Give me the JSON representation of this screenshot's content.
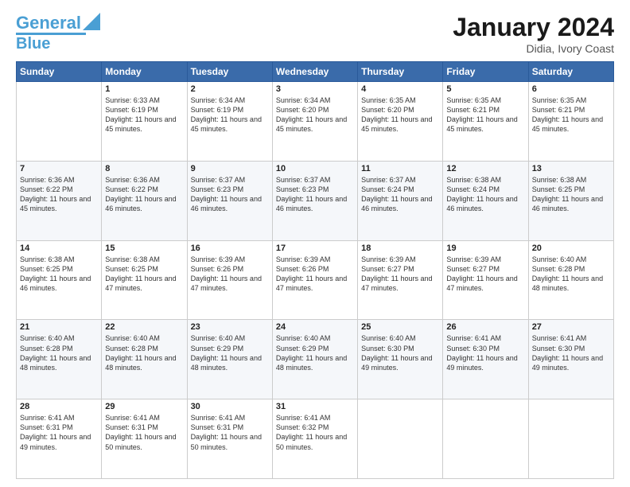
{
  "header": {
    "logo": {
      "line1": "General",
      "line2": "Blue"
    },
    "title": "January 2024",
    "location": "Didia, Ivory Coast"
  },
  "days_of_week": [
    "Sunday",
    "Monday",
    "Tuesday",
    "Wednesday",
    "Thursday",
    "Friday",
    "Saturday"
  ],
  "weeks": [
    [
      {
        "day": "",
        "sunrise": "",
        "sunset": "",
        "daylight": ""
      },
      {
        "day": "1",
        "sunrise": "Sunrise: 6:33 AM",
        "sunset": "Sunset: 6:19 PM",
        "daylight": "Daylight: 11 hours and 45 minutes."
      },
      {
        "day": "2",
        "sunrise": "Sunrise: 6:34 AM",
        "sunset": "Sunset: 6:19 PM",
        "daylight": "Daylight: 11 hours and 45 minutes."
      },
      {
        "day": "3",
        "sunrise": "Sunrise: 6:34 AM",
        "sunset": "Sunset: 6:20 PM",
        "daylight": "Daylight: 11 hours and 45 minutes."
      },
      {
        "day": "4",
        "sunrise": "Sunrise: 6:35 AM",
        "sunset": "Sunset: 6:20 PM",
        "daylight": "Daylight: 11 hours and 45 minutes."
      },
      {
        "day": "5",
        "sunrise": "Sunrise: 6:35 AM",
        "sunset": "Sunset: 6:21 PM",
        "daylight": "Daylight: 11 hours and 45 minutes."
      },
      {
        "day": "6",
        "sunrise": "Sunrise: 6:35 AM",
        "sunset": "Sunset: 6:21 PM",
        "daylight": "Daylight: 11 hours and 45 minutes."
      }
    ],
    [
      {
        "day": "7",
        "sunrise": "Sunrise: 6:36 AM",
        "sunset": "Sunset: 6:22 PM",
        "daylight": "Daylight: 11 hours and 45 minutes."
      },
      {
        "day": "8",
        "sunrise": "Sunrise: 6:36 AM",
        "sunset": "Sunset: 6:22 PM",
        "daylight": "Daylight: 11 hours and 46 minutes."
      },
      {
        "day": "9",
        "sunrise": "Sunrise: 6:37 AM",
        "sunset": "Sunset: 6:23 PM",
        "daylight": "Daylight: 11 hours and 46 minutes."
      },
      {
        "day": "10",
        "sunrise": "Sunrise: 6:37 AM",
        "sunset": "Sunset: 6:23 PM",
        "daylight": "Daylight: 11 hours and 46 minutes."
      },
      {
        "day": "11",
        "sunrise": "Sunrise: 6:37 AM",
        "sunset": "Sunset: 6:24 PM",
        "daylight": "Daylight: 11 hours and 46 minutes."
      },
      {
        "day": "12",
        "sunrise": "Sunrise: 6:38 AM",
        "sunset": "Sunset: 6:24 PM",
        "daylight": "Daylight: 11 hours and 46 minutes."
      },
      {
        "day": "13",
        "sunrise": "Sunrise: 6:38 AM",
        "sunset": "Sunset: 6:25 PM",
        "daylight": "Daylight: 11 hours and 46 minutes."
      }
    ],
    [
      {
        "day": "14",
        "sunrise": "Sunrise: 6:38 AM",
        "sunset": "Sunset: 6:25 PM",
        "daylight": "Daylight: 11 hours and 46 minutes."
      },
      {
        "day": "15",
        "sunrise": "Sunrise: 6:38 AM",
        "sunset": "Sunset: 6:25 PM",
        "daylight": "Daylight: 11 hours and 47 minutes."
      },
      {
        "day": "16",
        "sunrise": "Sunrise: 6:39 AM",
        "sunset": "Sunset: 6:26 PM",
        "daylight": "Daylight: 11 hours and 47 minutes."
      },
      {
        "day": "17",
        "sunrise": "Sunrise: 6:39 AM",
        "sunset": "Sunset: 6:26 PM",
        "daylight": "Daylight: 11 hours and 47 minutes."
      },
      {
        "day": "18",
        "sunrise": "Sunrise: 6:39 AM",
        "sunset": "Sunset: 6:27 PM",
        "daylight": "Daylight: 11 hours and 47 minutes."
      },
      {
        "day": "19",
        "sunrise": "Sunrise: 6:39 AM",
        "sunset": "Sunset: 6:27 PM",
        "daylight": "Daylight: 11 hours and 47 minutes."
      },
      {
        "day": "20",
        "sunrise": "Sunrise: 6:40 AM",
        "sunset": "Sunset: 6:28 PM",
        "daylight": "Daylight: 11 hours and 48 minutes."
      }
    ],
    [
      {
        "day": "21",
        "sunrise": "Sunrise: 6:40 AM",
        "sunset": "Sunset: 6:28 PM",
        "daylight": "Daylight: 11 hours and 48 minutes."
      },
      {
        "day": "22",
        "sunrise": "Sunrise: 6:40 AM",
        "sunset": "Sunset: 6:28 PM",
        "daylight": "Daylight: 11 hours and 48 minutes."
      },
      {
        "day": "23",
        "sunrise": "Sunrise: 6:40 AM",
        "sunset": "Sunset: 6:29 PM",
        "daylight": "Daylight: 11 hours and 48 minutes."
      },
      {
        "day": "24",
        "sunrise": "Sunrise: 6:40 AM",
        "sunset": "Sunset: 6:29 PM",
        "daylight": "Daylight: 11 hours and 48 minutes."
      },
      {
        "day": "25",
        "sunrise": "Sunrise: 6:40 AM",
        "sunset": "Sunset: 6:30 PM",
        "daylight": "Daylight: 11 hours and 49 minutes."
      },
      {
        "day": "26",
        "sunrise": "Sunrise: 6:41 AM",
        "sunset": "Sunset: 6:30 PM",
        "daylight": "Daylight: 11 hours and 49 minutes."
      },
      {
        "day": "27",
        "sunrise": "Sunrise: 6:41 AM",
        "sunset": "Sunset: 6:30 PM",
        "daylight": "Daylight: 11 hours and 49 minutes."
      }
    ],
    [
      {
        "day": "28",
        "sunrise": "Sunrise: 6:41 AM",
        "sunset": "Sunset: 6:31 PM",
        "daylight": "Daylight: 11 hours and 49 minutes."
      },
      {
        "day": "29",
        "sunrise": "Sunrise: 6:41 AM",
        "sunset": "Sunset: 6:31 PM",
        "daylight": "Daylight: 11 hours and 50 minutes."
      },
      {
        "day": "30",
        "sunrise": "Sunrise: 6:41 AM",
        "sunset": "Sunset: 6:31 PM",
        "daylight": "Daylight: 11 hours and 50 minutes."
      },
      {
        "day": "31",
        "sunrise": "Sunrise: 6:41 AM",
        "sunset": "Sunset: 6:32 PM",
        "daylight": "Daylight: 11 hours and 50 minutes."
      },
      {
        "day": "",
        "sunrise": "",
        "sunset": "",
        "daylight": ""
      },
      {
        "day": "",
        "sunrise": "",
        "sunset": "",
        "daylight": ""
      },
      {
        "day": "",
        "sunrise": "",
        "sunset": "",
        "daylight": ""
      }
    ]
  ]
}
